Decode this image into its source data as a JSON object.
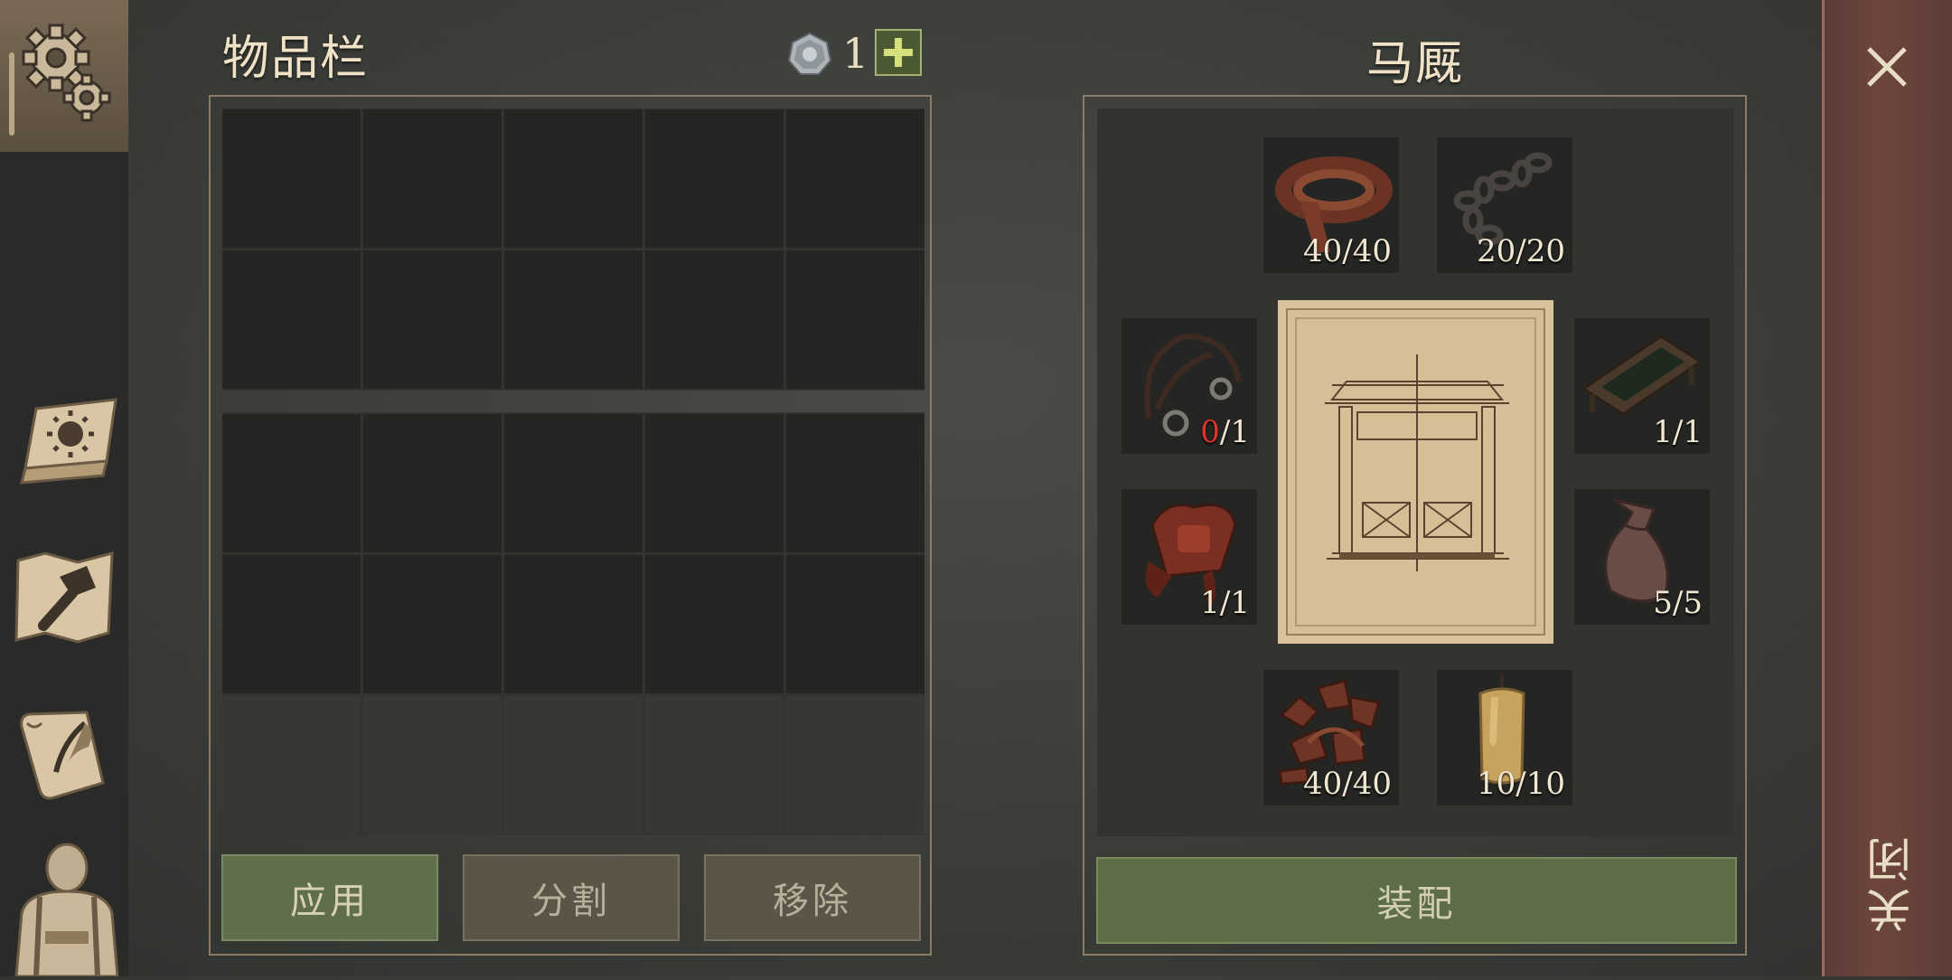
{
  "inventory": {
    "title": "物品栏",
    "coin_count": "1"
  },
  "actions": {
    "apply": "应用",
    "split": "分割",
    "remove": "移除"
  },
  "stable": {
    "title": "马厩",
    "materials": [
      {
        "name": "leather-strap",
        "have": "40",
        "need": "/40"
      },
      {
        "name": "chain",
        "have": "20",
        "need": "/20"
      },
      {
        "name": "bridle",
        "have": "0",
        "need": "/1",
        "missing": true
      },
      {
        "name": "feeding-trough",
        "have": "1",
        "need": "/1"
      },
      {
        "name": "saddle",
        "have": "1",
        "need": "/1"
      },
      {
        "name": "feed-sack",
        "have": "5",
        "need": "/5"
      },
      {
        "name": "leather-scraps",
        "have": "40",
        "need": "/40"
      },
      {
        "name": "candle",
        "have": "10",
        "need": "/10"
      }
    ],
    "equip_label": "装配"
  },
  "close": {
    "label": "关闭"
  },
  "colors": {
    "missing": "#e0332a",
    "button_green": "#5f6e4b",
    "close_strip": "#6e453d"
  }
}
